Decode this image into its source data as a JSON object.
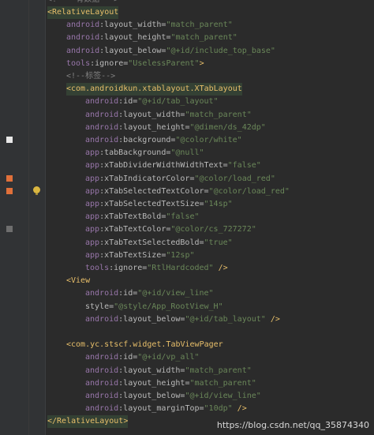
{
  "editor": {
    "top_comment": "<!--  有数据 -->",
    "lines": [
      {
        "t": "<RelativeLayout"
      },
      {
        "t": "android:layout_width=\"match_parent\""
      },
      {
        "t": "android:layout_height=\"match_parent\""
      },
      {
        "t": "android:layout_below=\"@+id/include_top_base\""
      },
      {
        "t": "tools:ignore=\"UselessParent\">"
      },
      {
        "t": "<!--标签-->"
      },
      {
        "t": "<com.androidkun.xtablayout.XTabLayout"
      },
      {
        "t": "android:id=\"@+id/tab_layout\""
      },
      {
        "t": "android:layout_width=\"match_parent\""
      },
      {
        "t": "android:layout_height=\"@dimen/ds_42dp\""
      },
      {
        "t": "android:background=\"@color/white\""
      },
      {
        "t": "app:tabBackground=\"@null\""
      },
      {
        "t": "app:xTabDividerWidthWidthText=\"false\""
      },
      {
        "t": "app:xTabIndicatorColor=\"@color/load_red\""
      },
      {
        "t": "app:xTabSelectedTextColor=\"@color/load_red\""
      },
      {
        "t": "app:xTabSelectedTextSize=\"14sp\""
      },
      {
        "t": "app:xTabTextBold=\"false\""
      },
      {
        "t": "app:xTabTextColor=\"@color/cs_727272\""
      },
      {
        "t": "app:xTabTextSelectedBold=\"true\""
      },
      {
        "t": "app:xTabTextSize=\"12sp\""
      },
      {
        "t": "tools:ignore=\"RtlHardcoded\" />"
      },
      {
        "t": "<View"
      },
      {
        "t": "android:id=\"@+id/view_line\""
      },
      {
        "t": "style=\"@style/App_RootView_H\""
      },
      {
        "t": "android:layout_below=\"@+id/tab_layout\" />"
      },
      {
        "t": ""
      },
      {
        "t": "<com.yc.stscf.widget.TabViewPager"
      },
      {
        "t": "android:id=\"@+id/vp_all\""
      },
      {
        "t": "android:layout_width=\"match_parent\""
      },
      {
        "t": "android:layout_height=\"match_parent\""
      },
      {
        "t": "android:layout_below=\"@+id/view_line\""
      },
      {
        "t": "android:layout_marginTop=\"10dp\" />"
      },
      {
        "t": "</RelativeLayout>"
      }
    ]
  },
  "watermark": "https://blog.csdn.net/qq_35874340",
  "colors": {
    "background": "#2b2b2b",
    "gutter": "#313335",
    "tag": "#e8bf6a",
    "attribute": "#bababa",
    "namespace": "#9876aa",
    "value": "#6a8759",
    "comment": "#808080"
  },
  "gutter_icons": [
    "white-square-icon",
    "orange-square-icon",
    "orange-square-icon",
    "lightbulb-icon",
    "gray-square-icon"
  ]
}
